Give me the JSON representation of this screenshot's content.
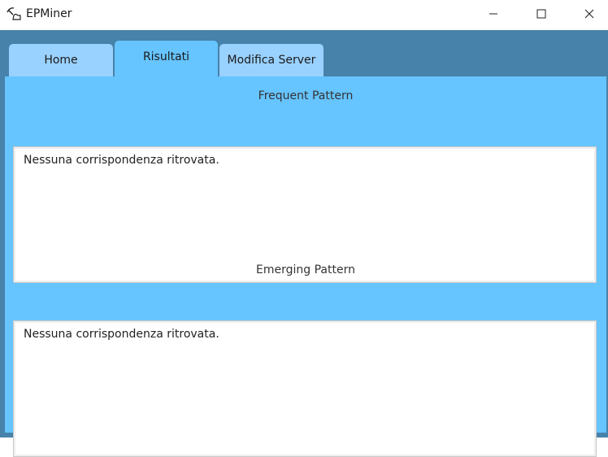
{
  "window": {
    "title": "EPMiner",
    "app_icon": "pickaxe-icon",
    "controls": [
      "minimize-icon",
      "maximize-icon",
      "close-icon"
    ]
  },
  "tabs": [
    {
      "label": "Home",
      "selected": false
    },
    {
      "label": "Risultati",
      "selected": true
    },
    {
      "label": "Modifica Server",
      "selected": false
    }
  ],
  "sections": {
    "frequent": {
      "title": "Frequent Pattern",
      "text": "Nessuna corrispondenza ritrovata."
    },
    "emerging": {
      "title": "Emerging Pattern",
      "text": "Nessuna corrispondenza ritrovata."
    }
  },
  "colors": {
    "frame": "#4682aa",
    "content": "#66c4ff",
    "tab_inactive": "#99d1ff",
    "tab_active": "#66c4ff"
  }
}
